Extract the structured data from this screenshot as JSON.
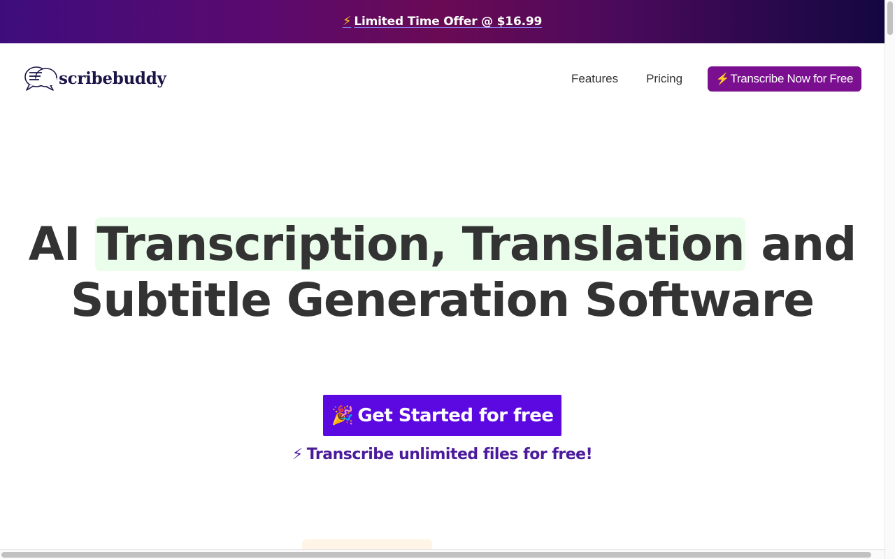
{
  "promo": {
    "icon": "lightning-icon",
    "text": "Limited Time Offer @ $16.99"
  },
  "header": {
    "logo_text": "scribebuddy",
    "nav": [
      {
        "label": "Features"
      },
      {
        "label": "Pricing"
      }
    ],
    "cta": {
      "icon": "lightning-icon",
      "label": "Transcribe Now for Free"
    }
  },
  "hero": {
    "title_part1": "AI ",
    "title_highlight": "Transcription, Translation",
    "title_part2": " and",
    "title_line2": "Subtitle Generation Software",
    "highlight_color": "#ebfdeb",
    "button": {
      "icon": "party-popper-icon",
      "label": "Get Started for free"
    },
    "subline": {
      "icon": "lightning-icon",
      "text": "Transcribe unlimited files for free!"
    }
  },
  "colors": {
    "primary_button": "#5b09e0",
    "cta_top": "#7a0f8f",
    "subline_text": "#4b1b9c",
    "title_text": "#333333"
  }
}
